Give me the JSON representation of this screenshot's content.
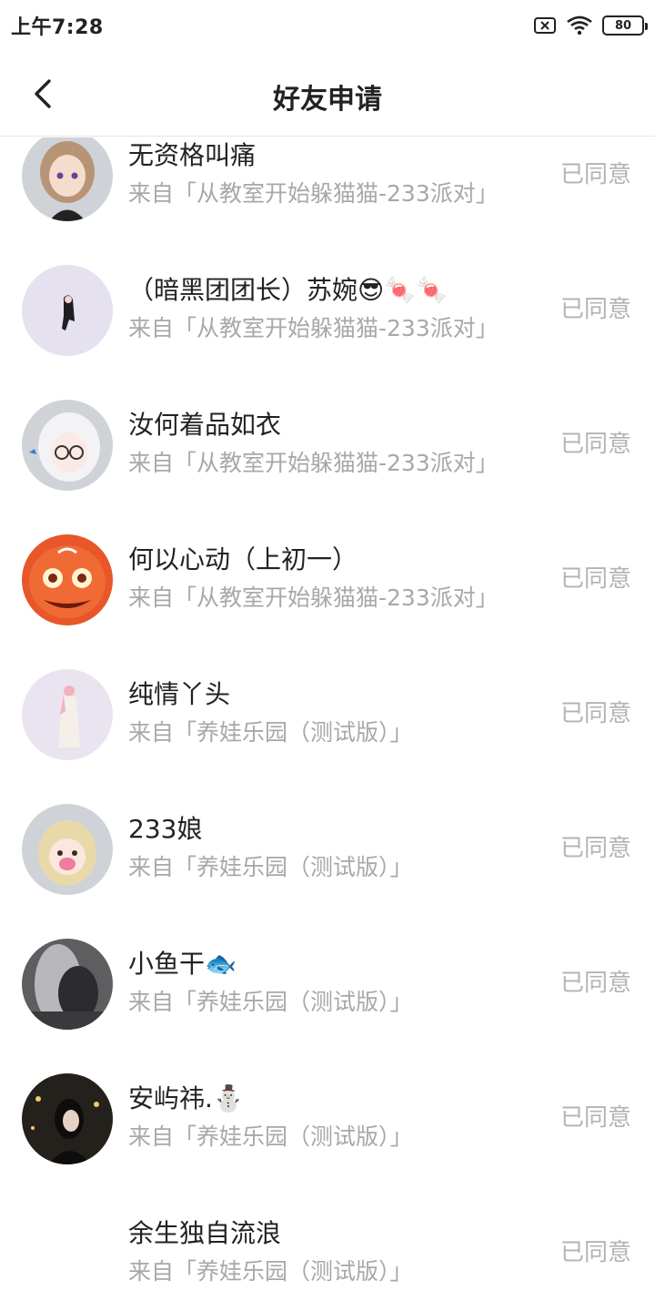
{
  "status_bar": {
    "time": "上午7:28",
    "battery": "80"
  },
  "header": {
    "title": "好友申请"
  },
  "requests": [
    {
      "name": "无资格叫痛",
      "source": "来自「从教室开始躲猫猫-233派对」",
      "status": "已同意"
    },
    {
      "name": "（暗黑团团长）苏婉😎🍬🍬",
      "source": "来自「从教室开始躲猫猫-233派对」",
      "status": "已同意"
    },
    {
      "name": "汝何着品如衣",
      "source": "来自「从教室开始躲猫猫-233派对」",
      "status": "已同意"
    },
    {
      "name": "何以心动（上初一）",
      "source": "来自「从教室开始躲猫猫-233派对」",
      "status": "已同意"
    },
    {
      "name": "纯情丫头",
      "source": "来自「养娃乐园（测试版）」",
      "status": "已同意"
    },
    {
      "name": "233娘",
      "source": "来自「养娃乐园（测试版）」",
      "status": "已同意"
    },
    {
      "name": "小鱼干🐟",
      "source": "来自「养娃乐园（测试版）」",
      "status": "已同意"
    },
    {
      "name": "安屿祎.⛄",
      "source": "来自「养娃乐园（测试版）」",
      "status": "已同意"
    },
    {
      "name": "余生独自流浪",
      "source": "来自「养娃乐园（测试版）」",
      "status": "已同意"
    }
  ]
}
